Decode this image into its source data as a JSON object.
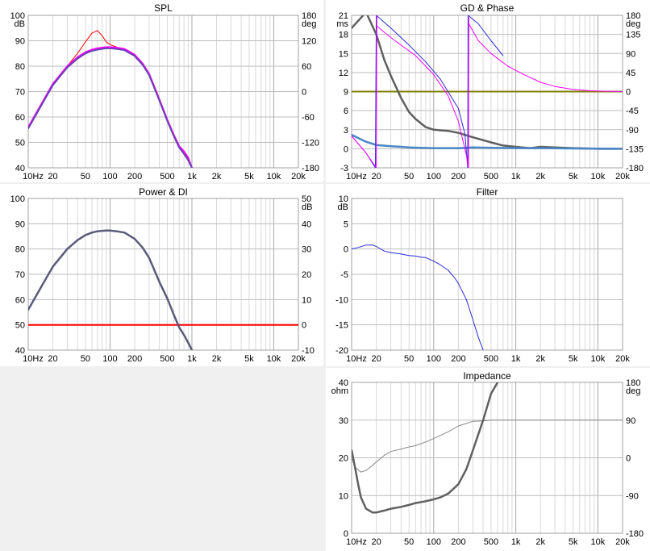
{
  "window": {
    "background": "#f0f0f0"
  },
  "chart_data": [
    {
      "id": "spl",
      "type": "line",
      "title": "SPL",
      "xscale": "log",
      "xlim": [
        10,
        20000
      ],
      "xticks": [
        "10Hz",
        "20",
        "50",
        "100",
        "200",
        "500",
        "1k",
        "2k",
        "5k",
        "10k",
        "20k"
      ],
      "ylim": [
        40,
        100
      ],
      "yticks": [
        "40",
        "50",
        "60",
        "70",
        "80",
        "90",
        "100"
      ],
      "yunit": "dB",
      "y2lim": [
        -180,
        180
      ],
      "y2ticks": [
        "-180",
        "-120",
        "-60",
        "0",
        "60",
        "120",
        "180"
      ],
      "y2unit": "deg",
      "grid": true,
      "series": [
        {
          "color": "#ff0000",
          "width": 1,
          "x": [
            10,
            15,
            20,
            30,
            40,
            50,
            60,
            70,
            80,
            90,
            100,
            120,
            150,
            200,
            250,
            300,
            400,
            500,
            600,
            700,
            800,
            900,
            1000
          ],
          "y": [
            56,
            66,
            73,
            80,
            85,
            89.5,
            93,
            94,
            92,
            89.5,
            88.5,
            87.5,
            86.5,
            84.5,
            81,
            77,
            67,
            59,
            53,
            48.5,
            46,
            43,
            40
          ]
        },
        {
          "color": "#ff00ff",
          "width": 2,
          "x": [
            10,
            15,
            20,
            30,
            40,
            50,
            60,
            70,
            80,
            90,
            100,
            120,
            150,
            200,
            250,
            300,
            400,
            500,
            600,
            700,
            800,
            900,
            1000
          ],
          "y": [
            56,
            66,
            73,
            80,
            83.5,
            85.5,
            86.5,
            87,
            87.3,
            87.5,
            87.5,
            87.3,
            86.8,
            84.5,
            81,
            77,
            67,
            59,
            53,
            48.5,
            46.5,
            44,
            40
          ]
        },
        {
          "color": "#6a3fb5",
          "width": 2,
          "x": [
            10,
            15,
            20,
            30,
            40,
            50,
            60,
            70,
            80,
            90,
            100,
            120,
            150,
            200,
            250,
            300,
            400,
            500,
            600,
            700,
            800,
            900,
            1000
          ],
          "y": [
            55.5,
            65.5,
            72.5,
            79.5,
            83,
            85,
            86,
            86.5,
            86.8,
            87,
            87,
            86.8,
            86.3,
            84,
            80.5,
            76.5,
            66.5,
            58.5,
            52.5,
            48,
            45.5,
            43,
            40
          ]
        }
      ]
    },
    {
      "id": "gd-phase",
      "type": "line",
      "title": "GD & Phase",
      "xscale": "log",
      "xlim": [
        10,
        20000
      ],
      "xticks": [
        "10Hz",
        "20",
        "50",
        "100",
        "200",
        "500",
        "1k",
        "2k",
        "5k",
        "10k",
        "20k"
      ],
      "ylim": [
        -3,
        21
      ],
      "yticks": [
        "-3",
        "0",
        "3",
        "6",
        "9",
        "12",
        "15",
        "18",
        "21"
      ],
      "yunit": "ms",
      "y2lim": [
        -180,
        180
      ],
      "y2ticks": [
        "-180",
        "-135",
        "-90",
        "-45",
        "0",
        "45",
        "90",
        "135",
        "180"
      ],
      "y2unit": "deg",
      "grid": true,
      "series": [
        {
          "color": "#808000",
          "width": 2,
          "axis": "y",
          "x": [
            10,
            20000
          ],
          "y": [
            9,
            9
          ]
        },
        {
          "color": "#606060",
          "width": 2.5,
          "axis": "y",
          "x": [
            10,
            15,
            20,
            25,
            30,
            40,
            50,
            60,
            70,
            80,
            100,
            120,
            150,
            200,
            300,
            500,
            700,
            1000,
            1500,
            2000,
            3000,
            5000,
            10000,
            20000
          ],
          "y": [
            19,
            21.5,
            18,
            14,
            11.5,
            8,
            5.8,
            4.7,
            4,
            3.4,
            3,
            2.9,
            2.8,
            2.5,
            1.8,
            1,
            0.5,
            0.3,
            0.1,
            0.3,
            0.2,
            0.1,
            0,
            0
          ]
        },
        {
          "color": "#4a86c5",
          "width": 2.5,
          "axis": "y",
          "x": [
            10,
            15,
            20,
            30,
            40,
            50,
            100,
            200,
            300,
            500,
            1000,
            2000,
            5000,
            10000,
            20000
          ],
          "y": [
            2.2,
            1.1,
            0.6,
            0.4,
            0.3,
            0.2,
            0.1,
            0.1,
            0.2,
            0.15,
            0.1,
            0.1,
            0.05,
            0,
            0
          ]
        },
        {
          "color": "#2a2ad8",
          "width": 1,
          "axis": "y2",
          "segments": [
            {
              "x": [
                10,
                15,
                19.5
              ],
              "y": [
                -105,
                -145,
                -180
              ]
            },
            {
              "x": [
                19.5,
                20
              ],
              "y": [
                -180,
                180
              ]
            },
            {
              "x": [
                20,
                30,
                50,
                80,
                120,
                200,
                240,
                260
              ],
              "y": [
                180,
                150,
                110,
                70,
                30,
                -40,
                -100,
                -180
              ]
            },
            {
              "x": [
                260,
                262
              ],
              "y": [
                -180,
                180
              ]
            },
            {
              "x": [
                262,
                350,
                500,
                700
              ],
              "y": [
                180,
                160,
                120,
                85
              ]
            }
          ]
        },
        {
          "color": "#ff00ff",
          "width": 1,
          "axis": "y2",
          "segments": [
            {
              "x": [
                10,
                15,
                20
              ],
              "y": [
                -105,
                -145,
                -180
              ]
            },
            {
              "x": [
                20,
                20.3
              ],
              "y": [
                -180,
                180
              ]
            },
            {
              "x": [
                20.3,
                25,
                35,
                60,
                100,
                150,
                200,
                250,
                265
              ],
              "y": [
                155,
                140,
                118,
                85,
                40,
                -10,
                -70,
                -150,
                -180
              ]
            },
            {
              "x": [
                265,
                268
              ],
              "y": [
                -180,
                175
              ]
            },
            {
              "x": [
                268,
                350,
                500,
                800,
                1200,
                2000,
                3000,
                5000,
                8000,
                12000,
                20000
              ],
              "y": [
                160,
                120,
                90,
                60,
                42,
                22,
                12,
                5,
                2,
                1,
                0
              ]
            }
          ]
        }
      ]
    },
    {
      "id": "power-di",
      "type": "line",
      "title": "Power & DI",
      "xscale": "log",
      "xlim": [
        10,
        20000
      ],
      "xticks": [
        "10Hz",
        "20",
        "50",
        "100",
        "200",
        "500",
        "1k",
        "2k",
        "5k",
        "10k",
        "20k"
      ],
      "ylim": [
        40,
        100
      ],
      "yticks": [
        "40",
        "50",
        "60",
        "70",
        "80",
        "90",
        "100"
      ],
      "y2lim": [
        -10,
        50
      ],
      "y2ticks": [
        "-10",
        "0",
        "10",
        "20",
        "30",
        "40",
        "50"
      ],
      "y2unit": "dB",
      "grid": true,
      "series": [
        {
          "color": "#ff0000",
          "width": 2,
          "axis": "y2",
          "x": [
            10,
            20000
          ],
          "y": [
            0,
            0
          ]
        },
        {
          "color": "#5a5a7a",
          "width": 2.5,
          "axis": "y",
          "x": [
            10,
            15,
            20,
            30,
            40,
            50,
            60,
            70,
            80,
            90,
            100,
            120,
            150,
            200,
            250,
            300,
            400,
            500,
            600,
            700,
            800,
            900,
            1000
          ],
          "y": [
            56,
            66,
            73,
            80,
            83.5,
            85.5,
            86.5,
            87,
            87.2,
            87.3,
            87.3,
            87,
            86.5,
            84,
            80.5,
            76.5,
            67,
            60.5,
            54,
            49,
            46,
            43,
            40
          ]
        }
      ]
    },
    {
      "id": "filter",
      "type": "line",
      "title": "Filter",
      "xscale": "log",
      "xlim": [
        10,
        20000
      ],
      "xticks": [
        "10Hz",
        "20",
        "50",
        "100",
        "200",
        "500",
        "1k",
        "2k",
        "5k",
        "10k",
        "20k"
      ],
      "ylim": [
        -20,
        10
      ],
      "yticks": [
        "-20",
        "-15",
        "-10",
        "-5",
        "0",
        "5",
        "10"
      ],
      "yunit": "dB",
      "grid": true,
      "series": [
        {
          "color": "#2a2ad8",
          "width": 1,
          "x": [
            10,
            12,
            15,
            18,
            20,
            25,
            30,
            40,
            50,
            60,
            70,
            80,
            100,
            120,
            150,
            180,
            200,
            250,
            300,
            350,
            400
          ],
          "y": [
            0,
            0.3,
            0.8,
            0.8,
            0.5,
            -0.4,
            -0.7,
            -1,
            -1.3,
            -1.4,
            -1.6,
            -1.7,
            -2.4,
            -3.1,
            -4.2,
            -5.7,
            -6.8,
            -10,
            -14,
            -17.5,
            -20
          ]
        }
      ]
    },
    {
      "id": "impedance",
      "type": "line",
      "title": "Impedance",
      "xscale": "log",
      "xlim": [
        10,
        20000
      ],
      "xticks": [
        "10Hz",
        "20",
        "50",
        "100",
        "200",
        "500",
        "1k",
        "2k",
        "5k",
        "10k",
        "20k"
      ],
      "ylim": [
        0,
        40
      ],
      "yticks": [
        "0",
        "10",
        "20",
        "30",
        "40"
      ],
      "yunit": "ohm",
      "y2lim": [
        -180,
        180
      ],
      "y2ticks": [
        "-180",
        "-90",
        "0",
        "90",
        "180"
      ],
      "y2unit": "deg",
      "grid": true,
      "series": [
        {
          "color": "#888888",
          "width": 1,
          "axis": "y2",
          "x": [
            10,
            11,
            12,
            13,
            15,
            18,
            20,
            25,
            30,
            40,
            50,
            60,
            80,
            100,
            150,
            200,
            300,
            400,
            500,
            1000,
            5000,
            20000
          ],
          "y": [
            0,
            -22,
            -29,
            -34,
            -30,
            -18,
            -10,
            6,
            15,
            21,
            26,
            29,
            38,
            46,
            62,
            76,
            87,
            88,
            90,
            90,
            90,
            90
          ]
        },
        {
          "color": "#606060",
          "width": 2.5,
          "axis": "y",
          "x": [
            10,
            11,
            12,
            13,
            15,
            18,
            20,
            25,
            30,
            40,
            50,
            60,
            80,
            100,
            120,
            150,
            200,
            250,
            300,
            400,
            500,
            600
          ],
          "y": [
            22,
            17.5,
            13,
            9.5,
            6.5,
            5.5,
            5.5,
            6,
            6.5,
            7,
            7.5,
            8,
            8.5,
            9,
            9.5,
            10.5,
            13,
            17,
            22,
            30,
            37,
            40
          ]
        }
      ]
    }
  ]
}
